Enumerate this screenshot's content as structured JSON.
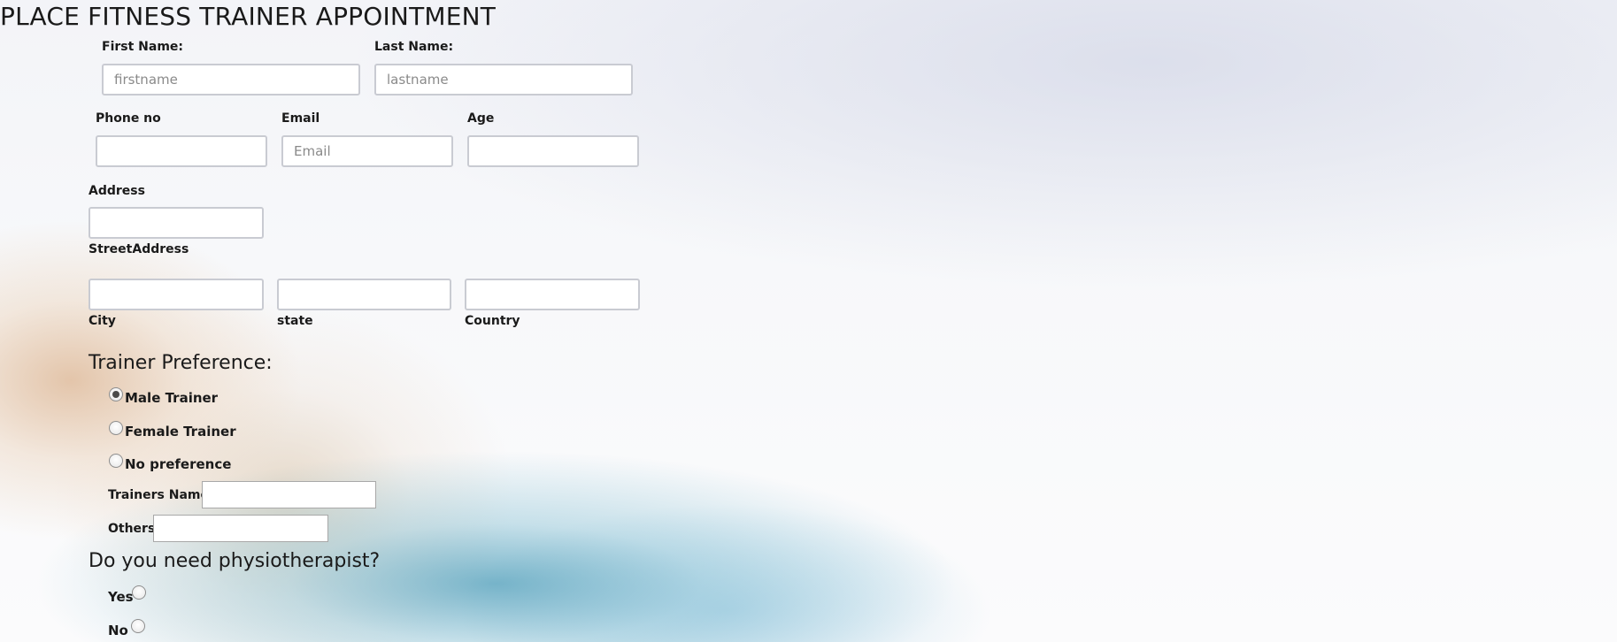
{
  "page": {
    "title": "PLACE FITNESS TRAINER APPOINTMENT"
  },
  "name_row": {
    "first_label": "First Name:",
    "first_placeholder": "firstname",
    "last_label": "Last Name:",
    "last_placeholder": "lastname"
  },
  "contact_row": {
    "phone_label": "Phone no",
    "email_label": "Email",
    "email_placeholder": "Email",
    "age_label": "Age"
  },
  "address": {
    "label": "Address",
    "street_label": "StreetAddress",
    "city_label": "City",
    "state_label": "state",
    "country_label": "Country"
  },
  "trainer_preference": {
    "heading": "Trainer Preference:",
    "options": [
      {
        "label": "Male Trainer",
        "checked": true
      },
      {
        "label": "Female Trainer",
        "checked": false
      },
      {
        "label": "No preference",
        "checked": false
      }
    ],
    "trainers_name_label": "Trainers Name",
    "others_label": "Others"
  },
  "physio": {
    "heading": "Do you need physiotherapist?",
    "yes_label": "Yes",
    "no_label": "No"
  }
}
